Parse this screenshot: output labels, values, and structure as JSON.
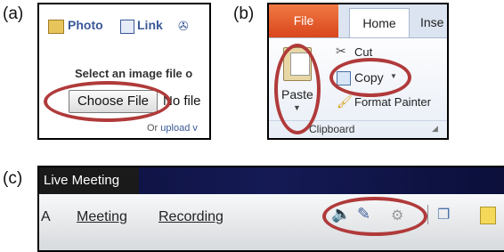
{
  "labels": {
    "a": "(a)",
    "b": "(b)",
    "c": "(c)"
  },
  "panel_a": {
    "toolbar": {
      "photo": "Photo",
      "link": "Link"
    },
    "prompt": "Select an image file o",
    "choose_file_button": "Choose File",
    "no_file_text": "No file",
    "footer_or": "Or",
    "footer_upload": "upload v"
  },
  "panel_b": {
    "tabs": {
      "file": "File",
      "home": "Home",
      "insert": "Inse"
    },
    "paste": "Paste",
    "cut": "Cut",
    "copy": "Copy",
    "format_painter": "Format Painter",
    "group": "Clipboard"
  },
  "panel_c": {
    "title": "Live Meeting",
    "menu": {
      "partial": "A",
      "meeting": "Meeting",
      "recording": "Recording"
    }
  },
  "colors": {
    "highlight_ring": "#b03a3a",
    "file_tab": "#e0562a",
    "titlebar": "#0b0f3a"
  }
}
